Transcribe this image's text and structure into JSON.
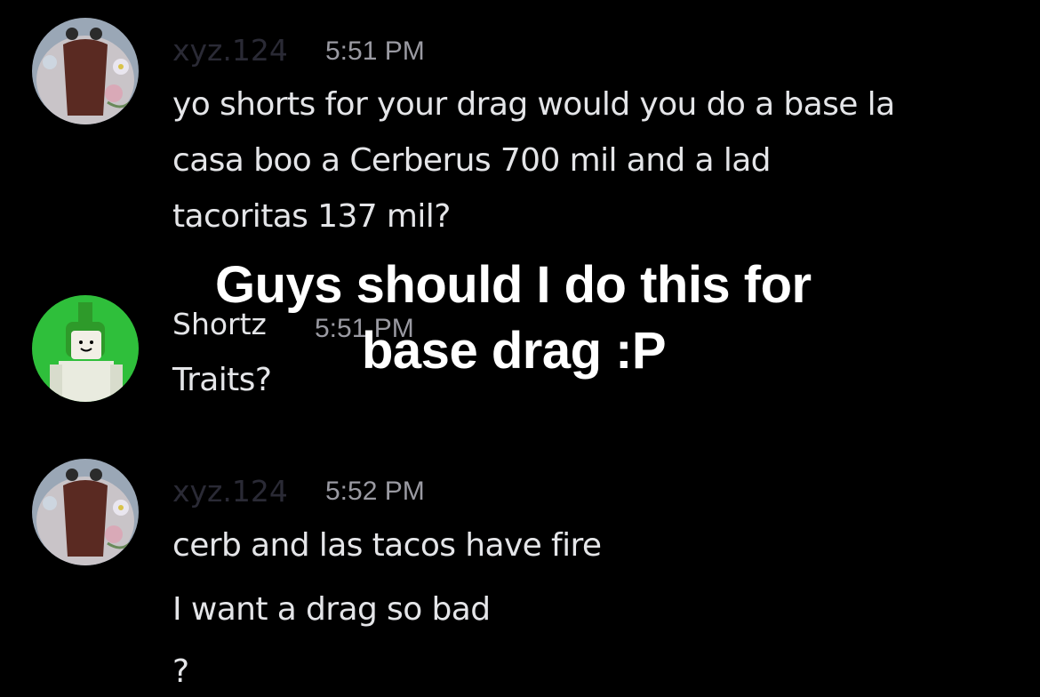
{
  "messages": [
    {
      "author": "xyz.124",
      "time": "5:51 PM",
      "author_color": "#2a2a35",
      "lines": [
        "yo shorts for your drag would you do a base la",
        "casa boo a Cerberus 700 mil and a lad",
        "tacoritas 137 mil?"
      ]
    },
    {
      "author": "Shortz",
      "time": "5:51 PM",
      "author_color": "#e4e5e8",
      "lines": [
        "Traits?"
      ]
    },
    {
      "author": "xyz.124",
      "time": "5:52 PM",
      "author_color": "#2a2a35",
      "lines": [
        "cerb and las tacos have fire",
        "I want a drag so bad",
        "?"
      ]
    }
  ],
  "overlay": {
    "line1": "Guys should I do this for",
    "line2": "base drag :P"
  },
  "colors": {
    "background": "#000000",
    "text": "#e4e5e8",
    "timestamp": "#9a9aa2",
    "overlay_text": "#ffffff",
    "shortz_avatar_bg": "#2fbf3b"
  }
}
